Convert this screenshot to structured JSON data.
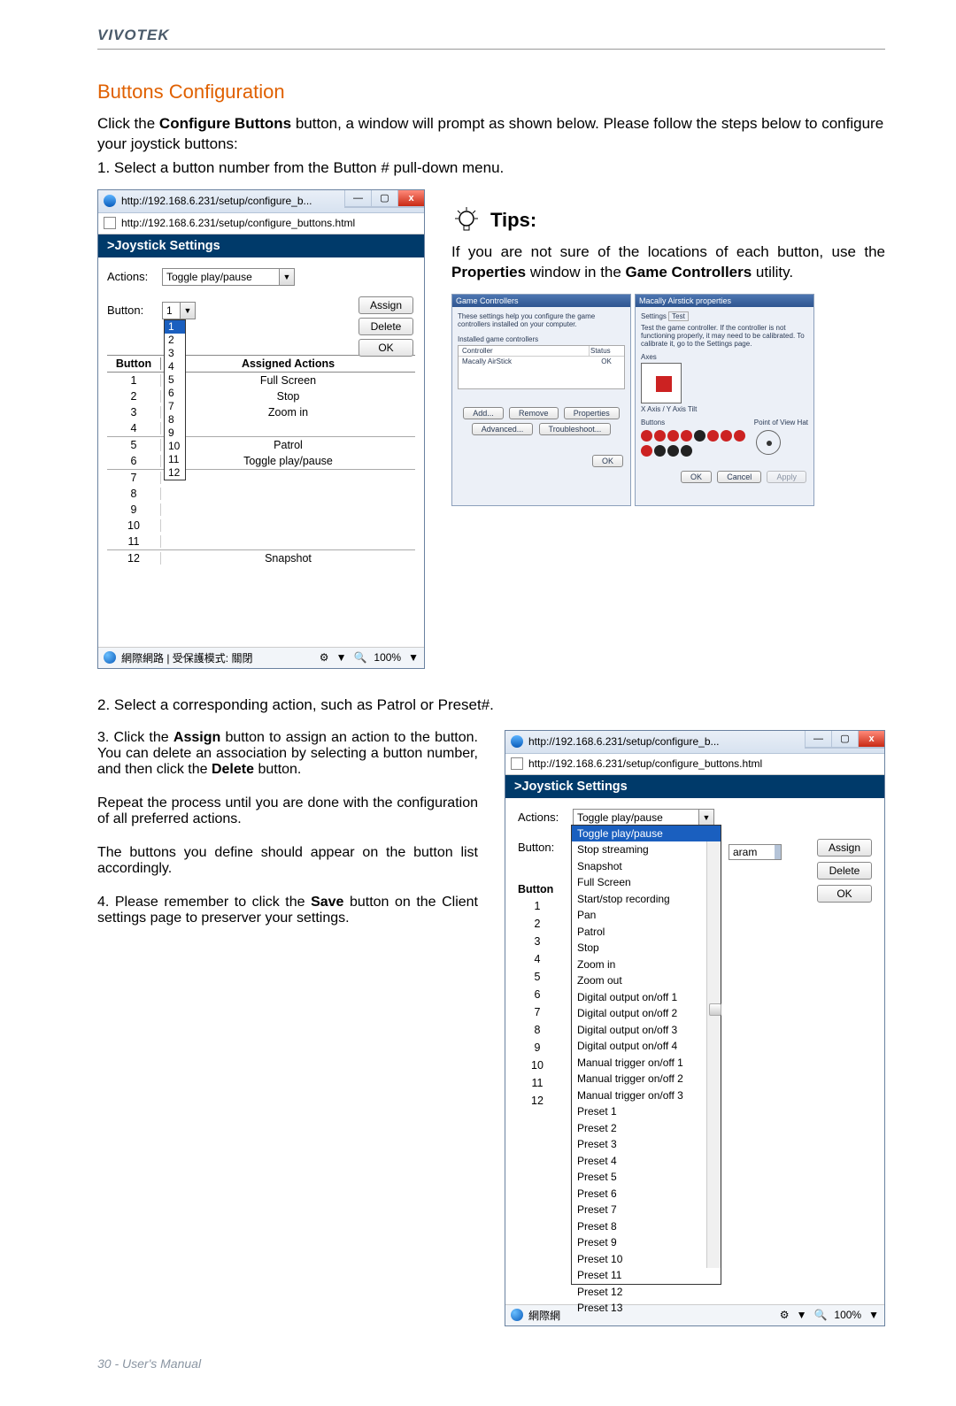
{
  "brand": "VIVOTEK",
  "section_title": "Buttons Configuration",
  "intro1_a": "Click the ",
  "intro1_b": "Configure Buttons",
  "intro1_c": " button, a window will prompt as shown below. Please follow the steps below to configure your joystick buttons:",
  "step1": "1. Select a button number from the Button # pull-down menu.",
  "win1": {
    "title": "http://192.168.6.231/setup/configure_b...",
    "url": "http://192.168.6.231/setup/configure_buttons.html",
    "pane": ">Joystick Settings",
    "actions_lbl": "Actions:",
    "actions_val": "Toggle play/pause",
    "button_lbl": "Button:",
    "button_val": "1",
    "assign": "Assign",
    "delete": "Delete",
    "ok": "OK",
    "dd": [
      "1",
      "2",
      "3",
      "4",
      "5",
      "6",
      "7",
      "8",
      "9",
      "10",
      "11",
      "12"
    ],
    "th_btn": "Button",
    "th_act": "Assigned Actions",
    "rows": [
      {
        "n": "1",
        "a": "Full Screen"
      },
      {
        "n": "2",
        "a": "Stop"
      },
      {
        "n": "3",
        "a": "Zoom in"
      },
      {
        "n": "4",
        "a": ""
      },
      {
        "n": "5",
        "a": "Patrol"
      },
      {
        "n": "6",
        "a": "Toggle play/pause"
      },
      {
        "n": "7",
        "a": ""
      },
      {
        "n": "8",
        "a": ""
      },
      {
        "n": "9",
        "a": ""
      },
      {
        "n": "10",
        "a": ""
      },
      {
        "n": "11",
        "a": ""
      },
      {
        "n": "12",
        "a": "Snapshot"
      }
    ],
    "status": "網際網路 | 受保護模式: 關閉",
    "zoom": "100%"
  },
  "tips_hdr": "Tips:",
  "tips_body_a": "If you are not sure of the locations of each button, use the ",
  "tips_body_b": "Properties",
  "tips_body_c": " window in the ",
  "tips_body_d": "Game Controllers",
  "tips_body_e": " utility.",
  "gc": {
    "left_title": "Game Controllers",
    "left_text": "These settings help you configure the game controllers installed on your computer.",
    "inst": "Installed game controllers",
    "ctrl": "Controller",
    "status": "Status",
    "ok": "OK",
    "items": [
      "Macally AirStick"
    ],
    "add": "Add...",
    "remove": "Remove",
    "prop": "Properties",
    "adv": "Advanced...",
    "trb": "Troubleshoot...",
    "right_title": "Macally Airstick properties",
    "settings": "Settings",
    "test": "Test",
    "right_text": "Test the game controller. If the controller is not functioning properly, it may need to be calibrated. To calibrate it, go to the Settings page.",
    "axes": "Axes",
    "xaxes": "X Axis / Y Axis   Tilt",
    "buttons": "Buttons",
    "pov": "Point of View Hat",
    "cancel": "Cancel",
    "apply": "Apply"
  },
  "step2": "2. Select a corresponding action, such as Patrol or Preset#.",
  "step3_a": "3. Click the ",
  "step3_b": "Assign",
  "step3_c": " button to assign an action to the button. You can delete an association by selecting a button number, and then click the ",
  "step3_d": "Delete",
  "step3_e": " button.",
  "para3a": "Repeat the process until you are done with the configuration of all preferred actions.",
  "para3b": "The buttons you define should appear on the button list accordingly.",
  "step4_a": "4. Please remember to click the ",
  "step4_b": "Save",
  "step4_c": " button on the Client settings page to preserver your settings.",
  "win2": {
    "title": "http://192.168.6.231/setup/configure_b...",
    "url": "http://192.168.6.231/setup/configure_buttons.html",
    "pane": ">Joystick Settings",
    "actions_lbl": "Actions:",
    "actions_val": "Toggle play/pause",
    "button_lbl": "Button:",
    "param": "aram",
    "assign": "Assign",
    "delete": "Delete",
    "ok": "OK",
    "options": [
      "Toggle play/pause",
      "Stop streaming",
      "Snapshot",
      "Full Screen",
      "Start/stop recording",
      "Pan",
      "Patrol",
      "Stop",
      "Zoom in",
      "Zoom out",
      "Digital output on/off 1",
      "Digital output on/off 2",
      "Digital output on/off 3",
      "Digital output on/off 4",
      "Manual trigger on/off 1",
      "Manual trigger on/off 2",
      "Manual trigger on/off 3",
      "Preset 1",
      "Preset 2",
      "Preset 3",
      "Preset 4",
      "Preset 5",
      "Preset 6",
      "Preset 7",
      "Preset 8",
      "Preset 9",
      "Preset 10",
      "Preset 11",
      "Preset 12",
      "Preset 13"
    ],
    "nums": [
      "1",
      "2",
      "3",
      "4",
      "5",
      "6",
      "7",
      "8",
      "9",
      "10",
      "11",
      "12"
    ],
    "th_btn": "Button",
    "status": "網際網",
    "zoom": "100%"
  },
  "footer": "30 - User's Manual"
}
